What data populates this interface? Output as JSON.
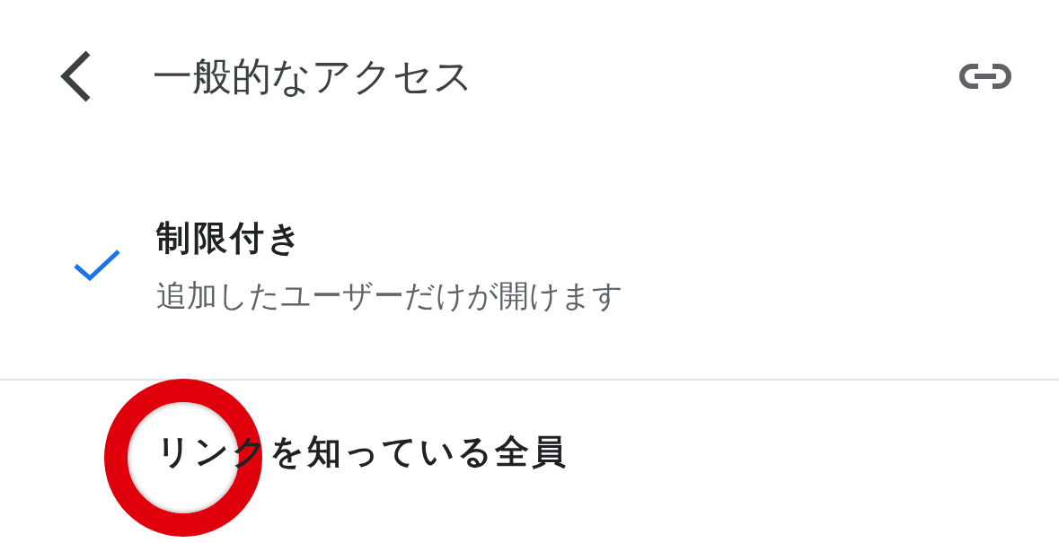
{
  "header": {
    "title": "一般的なアクセス"
  },
  "options": [
    {
      "title": "制限付き",
      "description": "追加したユーザーだけが開けます",
      "selected": true,
      "highlighted": false
    },
    {
      "title": "リンクを知っている全員",
      "selected": false,
      "highlighted": true
    }
  ]
}
